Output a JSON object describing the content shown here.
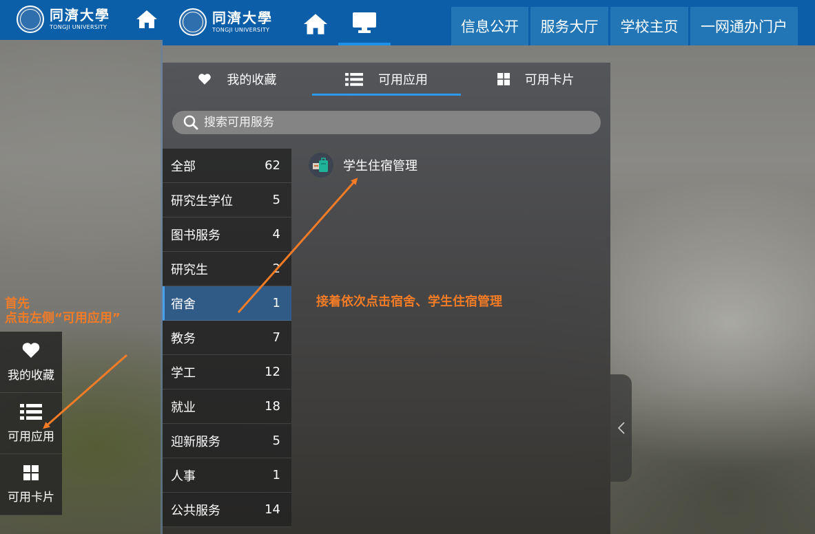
{
  "left_strip": {
    "logo": {
      "cn": "同濟大學",
      "en": "TONGJI UNIVERSITY"
    },
    "nav": [
      {
        "label": "我的收藏",
        "icon": "heart-icon"
      },
      {
        "label": "可用应用",
        "icon": "list-icon"
      },
      {
        "label": "可用卡片",
        "icon": "grid-icon"
      }
    ]
  },
  "topbar": {
    "logo": {
      "cn": "同濟大學",
      "en": "TONGJI UNIVERSITY"
    },
    "links": [
      "信息公开",
      "服务大厅",
      "学校主页",
      "一网通办门户"
    ]
  },
  "panel": {
    "tabs": [
      {
        "label": "我的收藏",
        "icon": "heart-icon",
        "active": false
      },
      {
        "label": "可用应用",
        "icon": "list-icon",
        "active": true
      },
      {
        "label": "可用卡片",
        "icon": "grid-icon",
        "active": false
      }
    ],
    "search": {
      "placeholder": "搜索可用服务"
    },
    "categories": [
      {
        "name": "全部",
        "count": "62"
      },
      {
        "name": "研究生学位",
        "count": "5"
      },
      {
        "name": "图书服务",
        "count": "4"
      },
      {
        "name": "研究生",
        "count": "2"
      },
      {
        "name": "宿舍",
        "count": "1",
        "active": true
      },
      {
        "name": "教务",
        "count": "7"
      },
      {
        "name": "学工",
        "count": "12"
      },
      {
        "name": "就业",
        "count": "18"
      },
      {
        "name": "迎新服务",
        "count": "5"
      },
      {
        "name": "人事",
        "count": "1"
      },
      {
        "name": "公共服务",
        "count": "14"
      }
    ],
    "apps": [
      {
        "label": "学生住宿管理",
        "icon": "luggage-icon"
      }
    ]
  },
  "annotations": {
    "left_line1": "首先",
    "left_line2": "点击左侧“可用应用”",
    "right": "接着依次点击宿舍、学生住宿管理"
  },
  "colors": {
    "topbar": "#0b5ea7",
    "accent": "#2b9af0",
    "annotation": "#f47c26",
    "active_category": "#2f5b86"
  }
}
